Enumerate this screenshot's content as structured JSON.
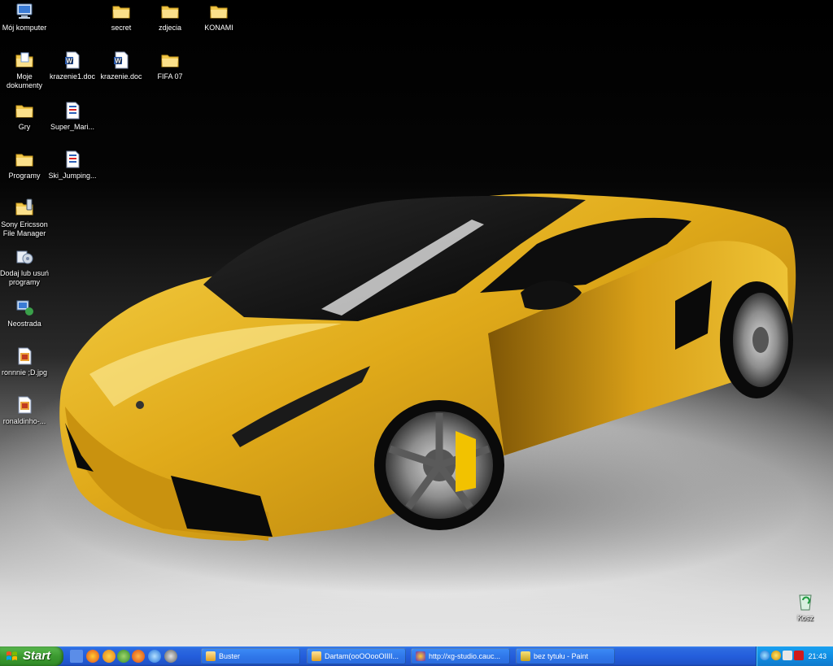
{
  "desktop": {
    "icons": [
      {
        "id": "my-computer",
        "label": "Mój komputer",
        "icon": "computer-icon"
      },
      {
        "id": "secret",
        "label": "secret",
        "icon": "folder-icon"
      },
      {
        "id": "zdjecia",
        "label": "zdjecia",
        "icon": "folder-icon"
      },
      {
        "id": "konami",
        "label": "KONAMI",
        "icon": "folder-icon"
      },
      {
        "id": "my-documents",
        "label": "Moje dokumenty",
        "icon": "documents-folder-icon"
      },
      {
        "id": "krazenie1",
        "label": "krazenie1.doc",
        "icon": "word-document-icon"
      },
      {
        "id": "krazenie",
        "label": "krazenie.doc",
        "icon": "word-document-icon"
      },
      {
        "id": "fifa07",
        "label": "FIFA 07",
        "icon": "folder-icon"
      },
      {
        "id": "gry",
        "label": "Gry",
        "icon": "folder-icon"
      },
      {
        "id": "super-mario",
        "label": "Super_Mari...",
        "icon": "shortcut-icon"
      },
      {
        "id": "programy",
        "label": "Programy",
        "icon": "folder-icon"
      },
      {
        "id": "ski-jumping",
        "label": "Ski_Jumping...",
        "icon": "shortcut-icon"
      },
      {
        "id": "sony-ericsson",
        "label": "Sony Ericsson File Manager",
        "icon": "phone-folder-icon"
      },
      {
        "id": "add-remove",
        "label": "Dodaj lub usuń programy",
        "icon": "add-remove-programs-icon"
      },
      {
        "id": "neostrada",
        "label": "Neostrada",
        "icon": "network-icon"
      },
      {
        "id": "ronnie",
        "label": "ronnnie ;D.jpg",
        "icon": "image-file-icon"
      },
      {
        "id": "ronaldinho",
        "label": "ronaldinho-...",
        "icon": "image-file-icon"
      },
      {
        "id": "recycle-bin",
        "label": "Kosz",
        "icon": "recycle-bin-icon"
      }
    ]
  },
  "taskbar": {
    "start_label": "Start",
    "quick_launch": [
      "show-desktop-icon",
      "browser-icon",
      "media-icon",
      "messenger-icon",
      "firefox-icon",
      "ie-icon",
      "media-player-icon"
    ],
    "tasks": [
      {
        "label": "Buster",
        "icon": "mail-icon"
      },
      {
        "label": "Dartam(ooOOooOIIII...",
        "icon": "mail-icon"
      },
      {
        "label": "http://xg-studio.cauc...",
        "icon": "browser-icon"
      },
      {
        "label": "bez tytułu - Paint",
        "icon": "paint-icon"
      }
    ],
    "tray_icons": [
      "network-tray-icon",
      "security-tray-icon",
      "volume-tray-icon",
      "antivirus-tray-icon"
    ],
    "clock": "21:43"
  },
  "colors": {
    "taskbar_blue": "#245edc",
    "start_green": "#3c9a30",
    "tray_blue": "#118ee3",
    "car_yellow": "#e8b820"
  }
}
